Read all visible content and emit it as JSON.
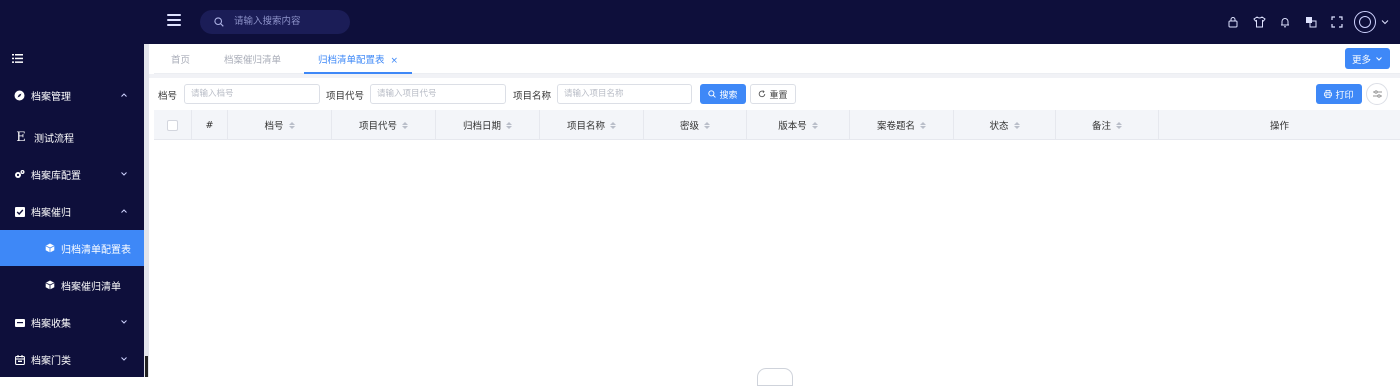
{
  "header": {
    "search_placeholder": "请输入搜索内容",
    "icons": [
      "lock-icon",
      "shirt-icon",
      "bell-icon",
      "translate-icon",
      "fullscreen-icon",
      "avatar",
      "chevron-down-icon"
    ]
  },
  "sidebar": {
    "items": [
      {
        "label": "档案管理",
        "icon": "compass-icon",
        "expanded": true
      },
      {
        "label": "测试流程",
        "icon": "e-icon"
      },
      {
        "label": "档案库配置",
        "icon": "gears-icon",
        "expanded": false
      },
      {
        "label": "档案催归",
        "icon": "checkbox-icon",
        "expanded": true
      },
      {
        "label": "归档清单配置表",
        "icon": "cube-icon",
        "active": true
      },
      {
        "label": "档案催归清单",
        "icon": "cube-icon"
      },
      {
        "label": "档案收集",
        "icon": "folder-icon",
        "expanded": false
      },
      {
        "label": "档案门类",
        "icon": "calendar-icon",
        "expanded": false
      }
    ]
  },
  "tabs": [
    {
      "label": "首页"
    },
    {
      "label": "档案催归清单"
    },
    {
      "label": "归档清单配置表",
      "active": true,
      "close": "×"
    }
  ],
  "more_button": "更多",
  "filters": {
    "f1_label": "档号",
    "f1_placeholder": "请输入档号",
    "f2_label": "项目代号",
    "f2_placeholder": "请输入项目代号",
    "f3_label": "项目名称",
    "f3_placeholder": "请输入项目名称",
    "search_button": "搜索",
    "reset_button": "重置",
    "print_button": "打印"
  },
  "table": {
    "columns": [
      "#",
      "档号",
      "项目代号",
      "归档日期",
      "项目名称",
      "密级",
      "版本号",
      "案卷题名",
      "状态",
      "备注",
      "操作"
    ],
    "rows": []
  },
  "colors": {
    "accent": "#3e88f7",
    "nav_bg": "#0e0f3b"
  }
}
